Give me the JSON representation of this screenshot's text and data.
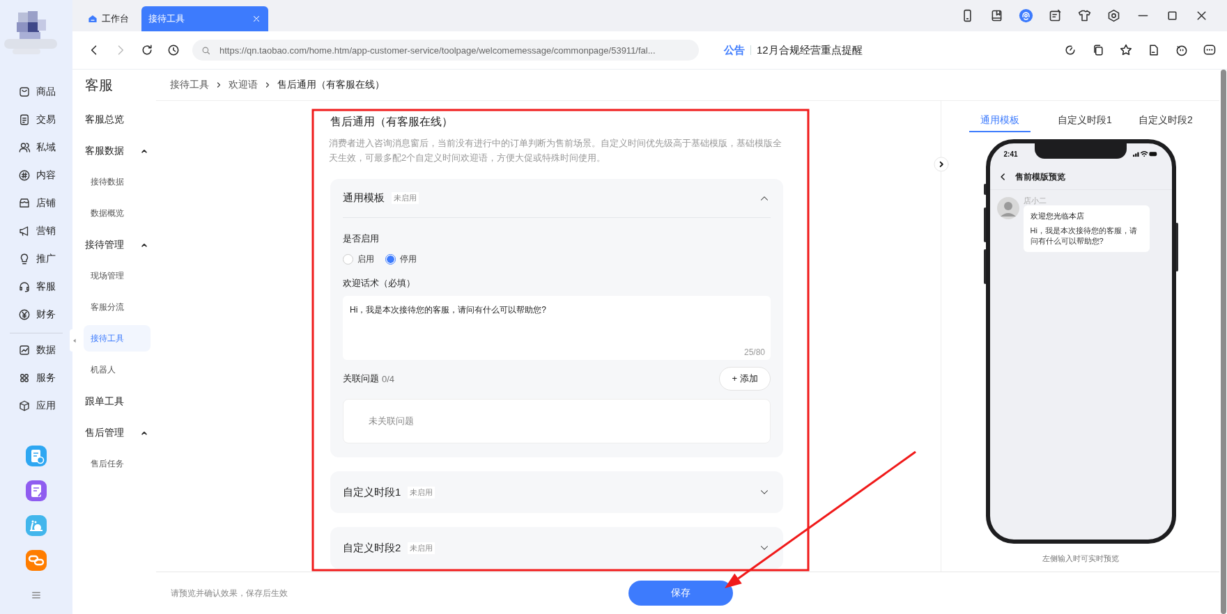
{
  "rail": {
    "groups": [
      [
        {
          "label": "商品",
          "selected": false
        },
        {
          "label": "交易",
          "selected": false
        },
        {
          "label": "私域",
          "selected": false
        },
        {
          "label": "内容",
          "selected": false
        },
        {
          "label": "店铺",
          "selected": false
        },
        {
          "label": "营销",
          "selected": false
        },
        {
          "label": "推广",
          "selected": false
        },
        {
          "label": "客服",
          "selected": false
        },
        {
          "label": "财务",
          "selected": false
        }
      ],
      [
        {
          "label": "数据",
          "selected": false
        },
        {
          "label": "服务",
          "selected": false
        },
        {
          "label": "应用",
          "selected": false
        }
      ]
    ]
  },
  "tabs": [
    {
      "label": "工作台",
      "selected": false,
      "closable": false
    },
    {
      "label": "接待工具",
      "selected": true,
      "closable": true
    }
  ],
  "address_bar": {
    "url": "https://qn.taobao.com/home.htm/app-customer-service/toolpage/welcomemessage/commonpage/53911/fal..."
  },
  "notice": {
    "tag": "公告",
    "text": "12月合规经营重点提醒"
  },
  "section_nav": {
    "title": "客服",
    "items": [
      {
        "label": "客服总览",
        "selected": false
      },
      {
        "label": "客服数据",
        "selected": false,
        "expanded": true,
        "children": [
          {
            "label": "接待数据",
            "selected": false
          },
          {
            "label": "数据概览",
            "selected": false
          }
        ]
      },
      {
        "label": "接待管理",
        "selected": false,
        "expanded": true,
        "children": [
          {
            "label": "现场管理",
            "selected": false
          },
          {
            "label": "客服分流",
            "selected": false
          },
          {
            "label": "接待工具",
            "selected": true
          },
          {
            "label": "机器人",
            "selected": false
          }
        ]
      },
      {
        "label": "跟单工具",
        "selected": false
      },
      {
        "label": "售后管理",
        "selected": false,
        "expanded": true,
        "children": [
          {
            "label": "售后任务",
            "selected": false
          }
        ]
      }
    ]
  },
  "breadcrumb": [
    "接待工具",
    "欢迎语",
    "售后通用（有客服在线）"
  ],
  "form": {
    "title": "售后通用（有客服在线）",
    "description": "消费者进入咨询消息窗后，当前没有进行中的订单判断为售前场景。自定义时间优先级高于基础模版，基础模版全天生效，可最多配2个自定义时间欢迎语，方便大促或特殊时间使用。",
    "panels": [
      {
        "title": "通用模板",
        "status": "未启用",
        "expanded": true,
        "enable_label": "是否启用",
        "options": [
          {
            "label": "启用",
            "selected": false
          },
          {
            "label": "停用",
            "selected": true
          }
        ],
        "message_label": "欢迎话术（必填）",
        "message": "Hi，我是本次接待您的客服，请问有什么可以帮助您?",
        "counter": "25/80",
        "related_label": "关联问题",
        "related_count": "0/4",
        "add_button": "+ 添加",
        "related_empty": "未关联问题"
      },
      {
        "title": "自定义时段1",
        "status": "未启用",
        "expanded": false
      },
      {
        "title": "自定义时段2",
        "status": "未启用",
        "expanded": false
      }
    ]
  },
  "preview": {
    "tabs": [
      {
        "label": "通用模板",
        "selected": true
      },
      {
        "label": "自定义时段1",
        "selected": false
      },
      {
        "label": "自定义时段2",
        "selected": false
      }
    ],
    "phone": {
      "time": "2:41",
      "title": "售前模版预览",
      "sender": "店小二",
      "bubble_title": "欢迎您光临本店",
      "bubble_text": "Hi，我是本次接待您的客服，请问有什么可以帮助您?"
    },
    "caption": "左侧输入时可实时预览"
  },
  "footer": {
    "hint": "请预览并确认效果，保存后生效",
    "save_button": "保存"
  },
  "annotations": [
    {
      "kind": "frame"
    },
    {
      "kind": "arrow"
    }
  ]
}
